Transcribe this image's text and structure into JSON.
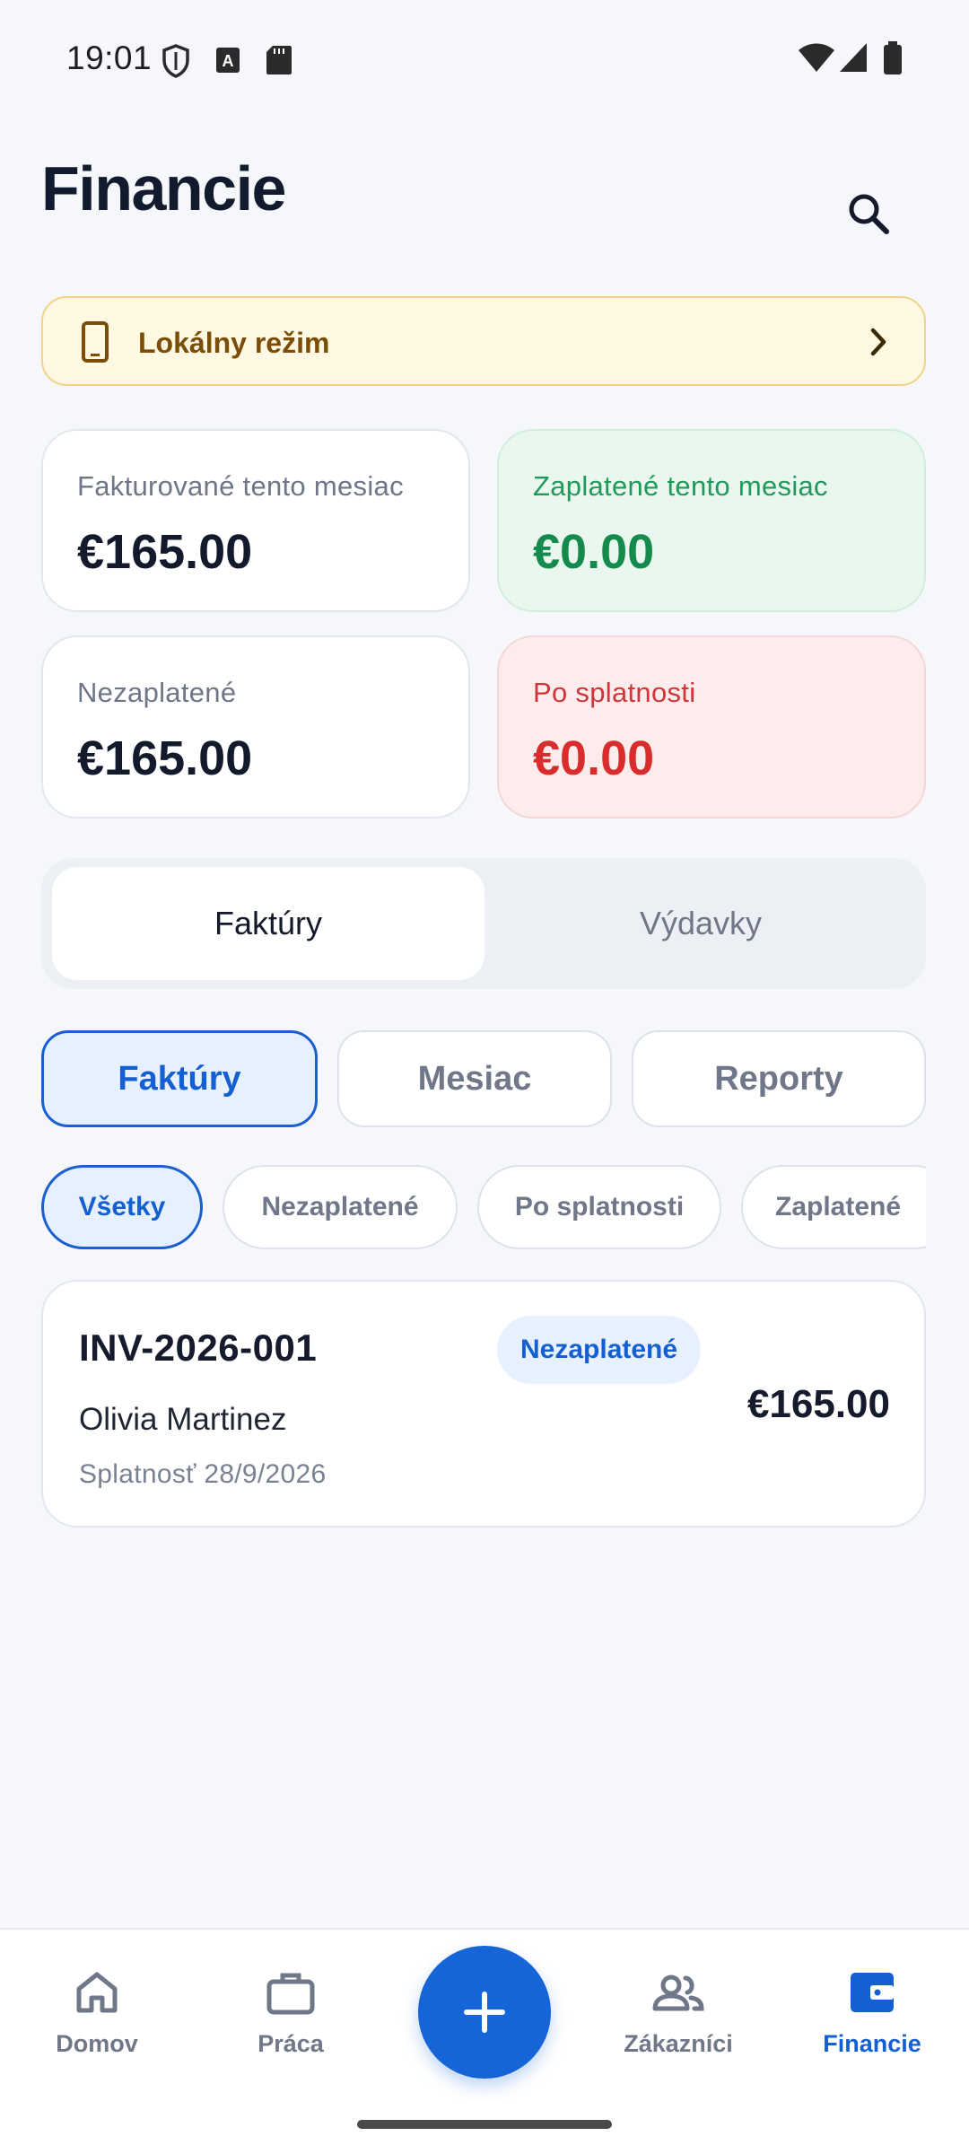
{
  "status_bar": {
    "time": "19:01",
    "icons_left": [
      "shield-icon",
      "font-a-icon",
      "sd-card-icon"
    ],
    "icons_right": [
      "wifi-icon",
      "signal-icon",
      "battery-icon"
    ]
  },
  "header": {
    "title": "Financie",
    "search_icon": "search-icon"
  },
  "banner": {
    "icon": "phone-icon",
    "label": "Lokálny režim",
    "chevron": "chevron-right-icon"
  },
  "stats": {
    "invoiced_month": {
      "label": "Fakturované tento mesiac",
      "value": "€165.00"
    },
    "paid_month": {
      "label": "Zaplatené tento mesiac",
      "value": "€0.00"
    },
    "unpaid": {
      "label": "Nezaplatené",
      "value": "€165.00"
    },
    "overdue": {
      "label": "Po splatnosti",
      "value": "€0.00"
    }
  },
  "segment": {
    "options": [
      "Faktúry",
      "Výdavky"
    ],
    "selected": "Faktúry"
  },
  "subtabs": {
    "options": [
      "Faktúry",
      "Mesiac",
      "Reporty"
    ],
    "selected": "Faktúry"
  },
  "filters": {
    "options": [
      "Všetky",
      "Nezaplatené",
      "Po splatnosti",
      "Zaplatené"
    ],
    "selected": "Všetky"
  },
  "invoices": [
    {
      "number": "INV-2026-001",
      "status": "Nezaplatené",
      "client": "Olivia Martinez",
      "due": "Splatnosť 28/9/2026",
      "amount": "€165.00"
    }
  ],
  "bottom_nav": {
    "items": [
      {
        "label": "Domov",
        "icon": "home-icon"
      },
      {
        "label": "Práca",
        "icon": "briefcase-icon"
      },
      {
        "label": "Zákazníci",
        "icon": "people-icon"
      },
      {
        "label": "Financie",
        "icon": "wallet-icon"
      }
    ],
    "active": "Financie",
    "fab_icon": "plus-icon"
  },
  "colors": {
    "accent": "#1565d8",
    "paid_green": "#148a4c",
    "overdue_red": "#d92d2d",
    "banner_bg": "#fff8e3",
    "banner_text": "#7a4e06"
  }
}
